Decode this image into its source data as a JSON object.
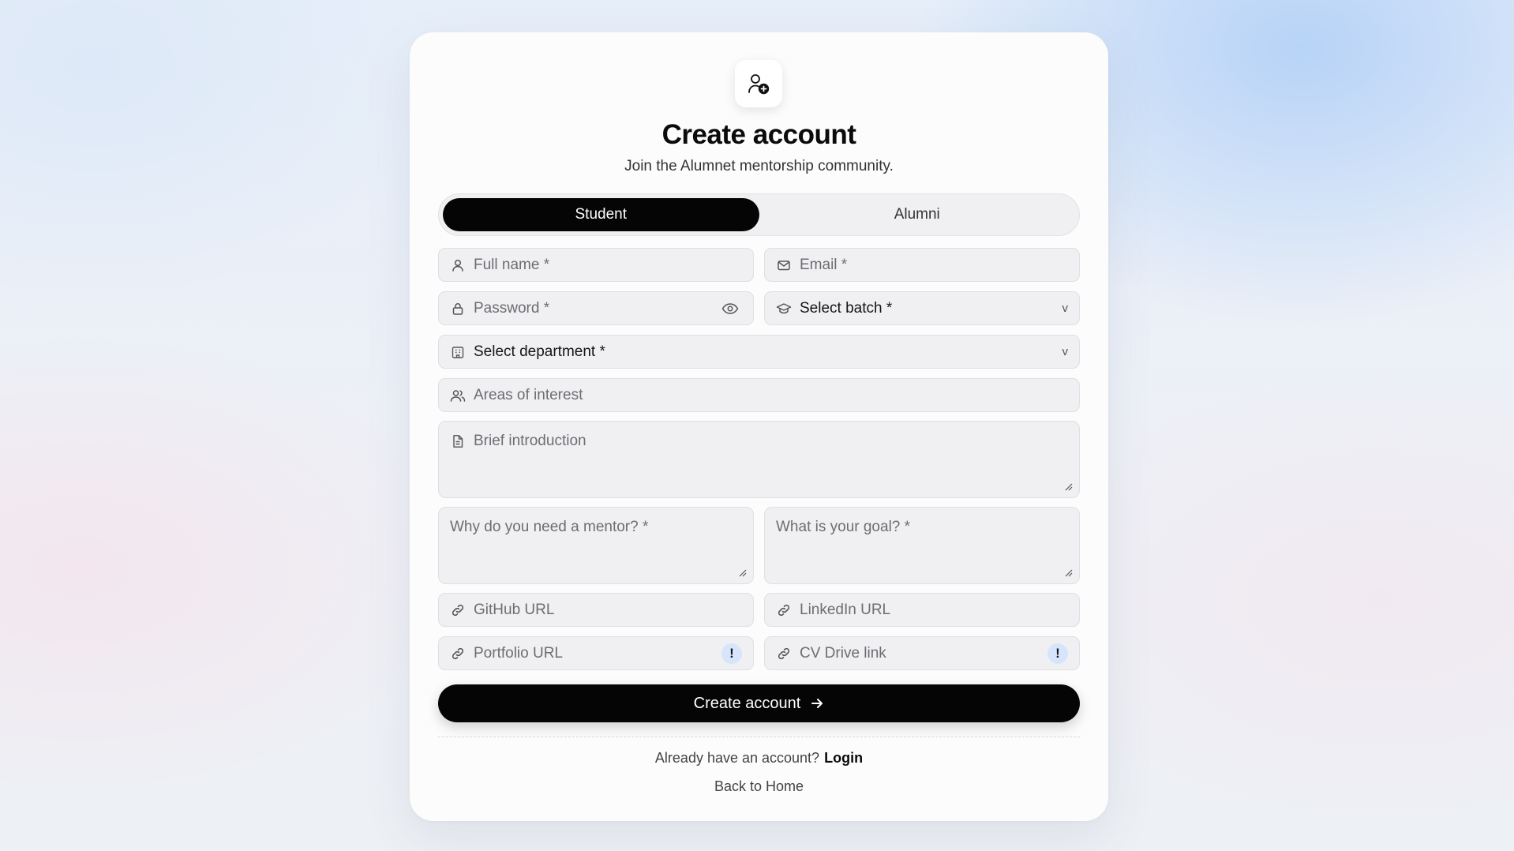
{
  "header": {
    "title": "Create account",
    "subtitle": "Join the Alumnet mentorship community."
  },
  "role_toggle": {
    "options": [
      "Student",
      "Alumni"
    ],
    "selected": "Student"
  },
  "form": {
    "full_name": {
      "placeholder": "Full name *",
      "icon": "user-icon"
    },
    "email": {
      "placeholder": "Email *",
      "icon": "mail-icon"
    },
    "password": {
      "placeholder": "Password *",
      "icon": "lock-icon",
      "toggle_icon": "eye-icon"
    },
    "batch": {
      "value": "Select batch *",
      "icon": "graduation-cap-icon",
      "chevron": "v"
    },
    "department": {
      "value": "Select department *",
      "icon": "building-icon",
      "chevron": "v"
    },
    "interests": {
      "placeholder": "Areas of interest",
      "icon": "users-icon"
    },
    "introduction": {
      "placeholder": "Brief introduction",
      "icon": "document-icon"
    },
    "mentor_reason": {
      "placeholder": "Why do you need a mentor? *"
    },
    "goal": {
      "placeholder": "What is your goal? *"
    },
    "github": {
      "placeholder": "GitHub URL",
      "icon": "link-icon"
    },
    "linkedin": {
      "placeholder": "LinkedIn URL",
      "icon": "link-icon"
    },
    "portfolio": {
      "placeholder": "Portfolio URL",
      "icon": "link-icon",
      "badge": "!"
    },
    "cv": {
      "placeholder": "CV Drive link",
      "icon": "link-icon",
      "badge": "!"
    }
  },
  "submit_label": "Create account",
  "footer": {
    "login_prompt": "Already have an account?",
    "login_link": "Login",
    "back_home": "Back to Home"
  },
  "colors": {
    "accent": "#050505",
    "field_bg": "#f0f0f3",
    "badge_bg": "#d6e5fb"
  }
}
